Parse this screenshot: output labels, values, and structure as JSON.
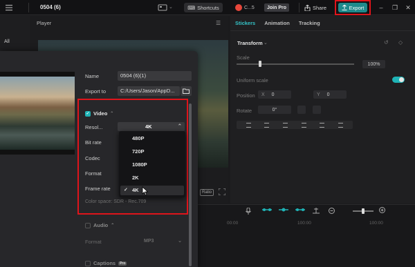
{
  "header": {
    "project_title": "0504 (6)",
    "shortcuts_label": "Shortcuts",
    "user_label": "C...5",
    "join_pro_label": "Join Pro",
    "share_label": "Share",
    "export_label": "Export"
  },
  "left_panel": {
    "all_tab_label": "All"
  },
  "player": {
    "title": "Player",
    "ratio_label": "Ratio"
  },
  "right_panel": {
    "tabs": [
      {
        "label": "Stickers",
        "active": true
      },
      {
        "label": "Animation",
        "active": false
      },
      {
        "label": "Tracking",
        "active": false
      }
    ],
    "section_title": "Transform",
    "scale_label": "Scale",
    "scale_value": "100%",
    "scale_fraction": 0.2,
    "uniform_scale_label": "Uniform scale",
    "uniform_scale_on": true,
    "position_label": "Position",
    "position_x": "0",
    "position_y": "0",
    "rotate_label": "Rotate",
    "rotate_value": "0°"
  },
  "export_dialog": {
    "name_label": "Name",
    "name_value": "0504 (6)(1)",
    "export_to_label": "Export to",
    "export_to_value": "C:/Users/Jason/AppD...",
    "video_section": {
      "title": "Video",
      "enabled": true,
      "resolution_label": "Resol...",
      "resolution_value": "4K",
      "bitrate_label": "Bit rate",
      "codec_label": "Codec",
      "format_label": "Format",
      "framerate_label": "Frame rate",
      "resolution_options": [
        "480P",
        "720P",
        "1080P",
        "2K",
        "4K"
      ],
      "selected_option": "4K",
      "color_space": "Color space: SDR - Rec.709"
    },
    "audio_section": {
      "title": "Audio",
      "format_label": "Format",
      "format_value": "MP3"
    },
    "captions_section": {
      "title": "Captions",
      "badge": "Pro"
    }
  },
  "timeline": {
    "time_marks": [
      "00:00",
      "100:00",
      "100:00"
    ]
  },
  "colors": {
    "accent": "#1fb3b6",
    "highlight": "#e0141b",
    "export_button": "#1f8a8c"
  }
}
